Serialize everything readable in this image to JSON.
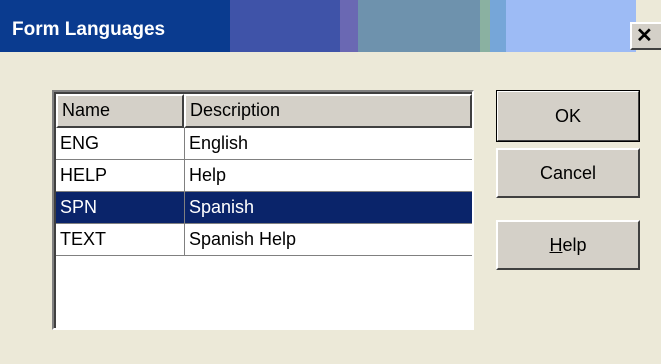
{
  "window": {
    "title": "Form Languages",
    "close_glyph": "✕"
  },
  "listview": {
    "columns": [
      "Name",
      "Description"
    ],
    "rows": [
      {
        "name": "ENG",
        "description": "English",
        "selected": false
      },
      {
        "name": "HELP",
        "description": "Help",
        "selected": false
      },
      {
        "name": "SPN",
        "description": "Spanish",
        "selected": true
      },
      {
        "name": "TEXT",
        "description": "Spanish Help",
        "selected": false
      }
    ]
  },
  "buttons": {
    "ok": "OK",
    "cancel": "Cancel",
    "help_mnemonic": "H",
    "help_rest": "elp"
  },
  "colors": {
    "selection": "#0a246a",
    "face": "#ece9d8",
    "button_face": "#d4d0c8"
  }
}
